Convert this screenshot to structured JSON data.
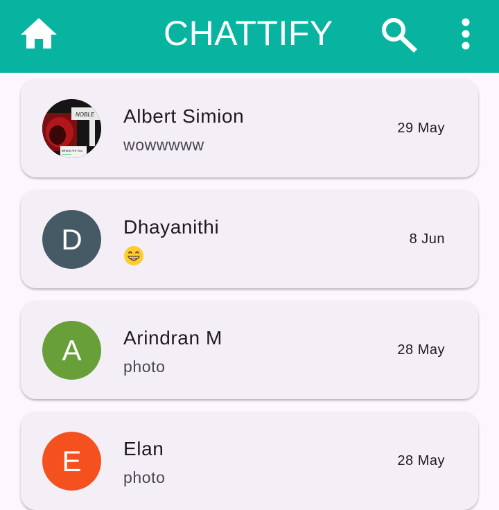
{
  "appbar": {
    "title": "CHATTIFY",
    "background": "#08b4a0",
    "icons": [
      "home-icon",
      "search-icon",
      "more-vert-icon"
    ]
  },
  "chats": [
    {
      "name": "Albert Simion",
      "preview": "wowwwww",
      "date": "29 May",
      "avatar_type": "photo",
      "avatar_photo_text": [
        "NOBLE",
        "Where Are You"
      ]
    },
    {
      "name": "Dhayanithi",
      "preview": "😁",
      "date": "8 Jun",
      "avatar_type": "initial",
      "initial": "D",
      "avatar_color": "#455a64"
    },
    {
      "name": "Arindran M",
      "preview": "photo",
      "date": "28 May",
      "avatar_type": "initial",
      "initial": "A",
      "avatar_color": "#689f38"
    },
    {
      "name": "Elan",
      "preview": "photo",
      "date": "28 May",
      "avatar_type": "initial",
      "initial": "E",
      "avatar_color": "#f4511e"
    }
  ]
}
